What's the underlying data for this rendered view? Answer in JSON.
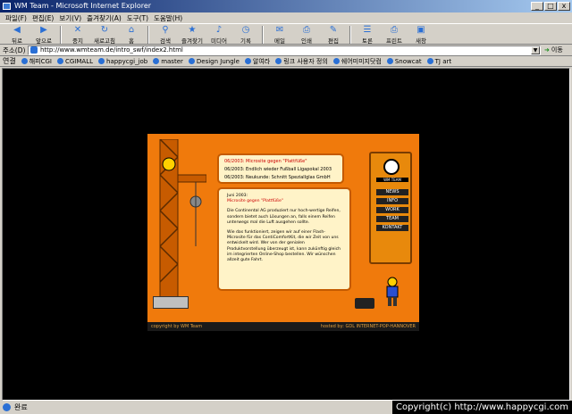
{
  "window": {
    "title": "WM Team - Microsoft Internet Explorer",
    "min": "_",
    "max": "□",
    "close": "x"
  },
  "menu": [
    "파일(F)",
    "편집(E)",
    "보기(V)",
    "즐겨찾기(A)",
    "도구(T)",
    "도움말(H)"
  ],
  "toolbar": [
    {
      "label": "뒤로",
      "icon": "back-icon"
    },
    {
      "label": "앞으로",
      "icon": "forward-icon"
    },
    {
      "label": "중지",
      "icon": "stop-icon"
    },
    {
      "label": "새로고침",
      "icon": "refresh-icon"
    },
    {
      "label": "홈",
      "icon": "home-icon"
    },
    {
      "label": "검색",
      "icon": "search-icon"
    },
    {
      "label": "즐겨찾기",
      "icon": "favorites-icon"
    },
    {
      "label": "미디어",
      "icon": "media-icon"
    },
    {
      "label": "기록",
      "icon": "history-icon"
    },
    {
      "label": "메일",
      "icon": "mail-icon"
    },
    {
      "label": "인쇄",
      "icon": "print-icon"
    },
    {
      "label": "편집",
      "icon": "edit-icon"
    },
    {
      "label": "토론",
      "icon": "discuss-icon"
    },
    {
      "label": "프린트",
      "icon": "print2-icon"
    },
    {
      "label": "새창",
      "icon": "new-window-icon"
    }
  ],
  "address": {
    "label": "주소(D)",
    "value": "http://www.wmteam.de/intro_swf/index2.html",
    "go": "이동"
  },
  "links": {
    "label": "연결",
    "items": [
      "해피CGI",
      "CGIMALL",
      "happycgi_job",
      "master",
      "Design Jungle",
      "알여라",
      "링크 사용자 정의",
      "쉐어미미지닷컴",
      "Snowcat",
      "TJ art"
    ]
  },
  "flash": {
    "news": [
      "06/2003: Microsite gegen \"Plattfüße\"",
      "06/2003: Endlich wieder Fußball Ligapokal 2003",
      "06/2003: Neukunde: Schnitt Speziallglas GmbH"
    ],
    "content": {
      "date": "Juni 2003:",
      "headline": "Microsite gegen \"Plattfüße\"",
      "p1": "Die Continental AG produziert nur hoch-wertige Reifen, sondern bietet auch Lösungen an, falls einem Reifen unterwegs mal die Luft ausgehen sollte.",
      "p2": "Wie das funktioniert, zeigen wir auf einer Flash-Microsite für das ContiComfortKit, die wir Zeit von uns entwickelt wird. Wer von der genialen Produktvorstellung überzeugt ist, kann zukünftig gleich im integrierten Online-Shop bestellen. Wir wünschen allzeit gute Fahrt."
    },
    "logo_text": "WM TEAM",
    "nav": [
      "NEWS",
      "INFO",
      "WORK",
      "TEAM",
      "KONTAKT"
    ],
    "footer_left": "copyright by WM Team",
    "footer_right": "hosted by: GDL INTERNET-POP-HANNOVER"
  },
  "status": {
    "text": "완료"
  },
  "watermark": "Copyright(c) http://www.happycgi.com"
}
